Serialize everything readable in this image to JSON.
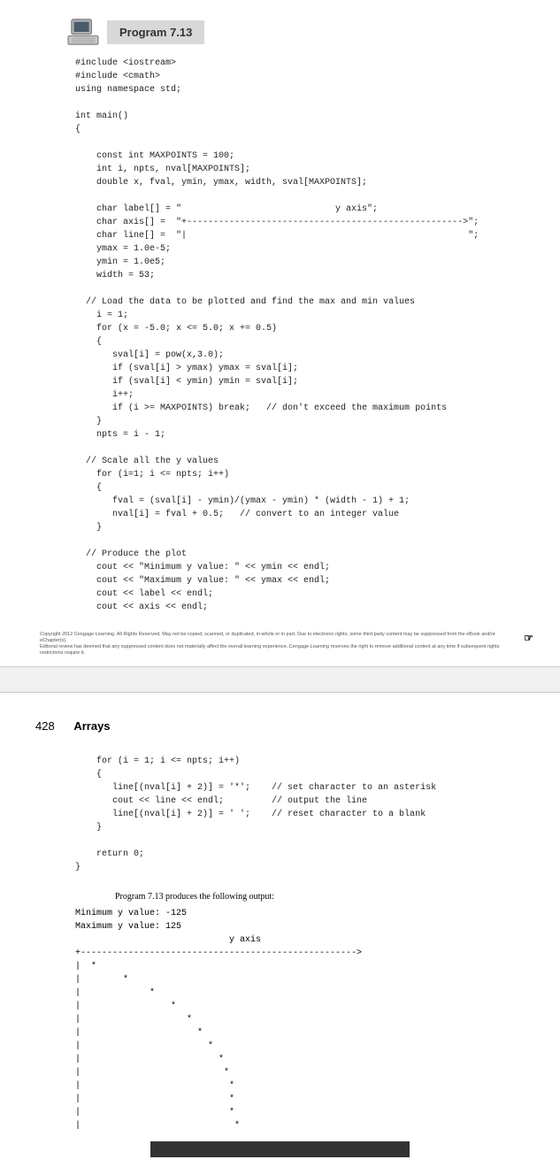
{
  "program": {
    "title": "Program 7.13",
    "code_lines": [
      "#include <iostream>",
      "#include <cmath>",
      "using namespace std;",
      "",
      "int main()",
      "{",
      "",
      "    const int MAXPOINTS = 100;",
      "    int i, npts, nval[MAXPOINTS];",
      "    double x, fval, ymin, ymax, width, sval[MAXPOINTS];",
      "",
      "    char label[] = \"                             y axis\";",
      "    char axis[] =  \"+---------------------------------------------------->\";",
      "    char line[] =  \"|                                                     \";",
      "    ymax = 1.0e-5;",
      "    ymin = 1.0e5;",
      "    width = 53;",
      "",
      "  // Load the data to be plotted and find the max and min values",
      "    i = 1;",
      "    for (x = -5.0; x <= 5.0; x += 0.5)",
      "    {",
      "       sval[i] = pow(x,3.0);",
      "       if (sval[i] > ymax) ymax = sval[i];",
      "       if (sval[i] < ymin) ymin = sval[i];",
      "       i++;",
      "       if (i >= MAXPOINTS) break;   // don't exceed the maximum points",
      "    }",
      "    npts = i - 1;",
      "",
      "  // Scale all the y values",
      "    for (i=1; i <= npts; i++)",
      "    {",
      "       fval = (sval[i] - ymin)/(ymax - ymin) * (width - 1) + 1;",
      "       nval[i] = fval + 0.5;   // convert to an integer value",
      "    }",
      "",
      "  // Produce the plot",
      "    cout << \"Minimum y value: \" << ymin << endl;",
      "    cout << \"Maximum y value: \" << ymax << endl;",
      "    cout << label << endl;",
      "    cout << axis << endl;"
    ]
  },
  "copyright": {
    "line1": "Copyright 2012 Cengage Learning. All Rights Reserved. May not be copied, scanned, or duplicated, in whole or in part. Due to electronic rights, some third party content may be suppressed from the eBook and/or eChapter(s).",
    "line2": "Editorial review has deemed that any suppressed content does not materially affect the overall learning experience. Cengage Learning reserves the right to remove additional content at any time if subsequent rights restrictions require it."
  },
  "page2": {
    "page_number": "428",
    "chapter_title": "Arrays",
    "code_lines": [
      "    for (i = 1; i <= npts; i++)",
      "    {",
      "       line[(nval[i] + 2)] = '*';    // set character to an asterisk",
      "       cout << line << endl;         // output the line",
      "       line[(nval[i] + 2)] = ' ';    // reset character to a blank",
      "    }",
      "",
      "    return 0;",
      "}"
    ],
    "output_intro": "Program 7.13 produces the following output:",
    "output_lines": [
      "Minimum y value: -125",
      "Maximum y value: 125",
      "                             y axis",
      "+---------------------------------------------------->",
      "|  *",
      "|        *",
      "|             *",
      "|                 *",
      "|                    *",
      "|                      *",
      "|                        *",
      "|                          *",
      "|                           *",
      "|                            *",
      "|                            *",
      "|                            *",
      "|                             *"
    ]
  },
  "page_break_icon": "☞"
}
